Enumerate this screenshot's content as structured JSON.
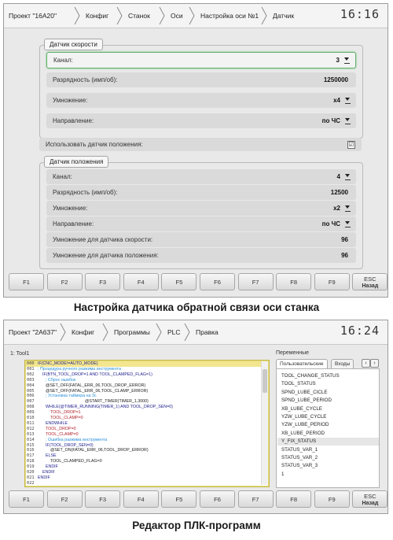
{
  "screen1": {
    "breadcrumb": [
      "Проект \"16А20\"",
      "Конфиг",
      "Станок",
      "Оси",
      "Настройка оси №1",
      "Датчик"
    ],
    "clock": "16:16",
    "speed_group": {
      "legend": "Датчик скорости",
      "rows": [
        {
          "label": "Канал:",
          "value": "3",
          "dropdown": true
        },
        {
          "label": "Разрядность (имп/об):",
          "value": "1250000",
          "dropdown": false
        },
        {
          "label": "Умножение:",
          "value": "x4",
          "dropdown": true
        },
        {
          "label": "Направление:",
          "value": "по ЧС",
          "dropdown": true
        }
      ]
    },
    "use_position_sensor": {
      "label": "Использовать датчик положения:",
      "checked": "☑"
    },
    "position_group": {
      "legend": "Датчик положения",
      "rows": [
        {
          "label": "Канал:",
          "value": "4",
          "dropdown": true
        },
        {
          "label": "Разрядность (имп/об):",
          "value": "12500",
          "dropdown": false
        },
        {
          "label": "Умножение:",
          "value": "x2",
          "dropdown": true
        },
        {
          "label": "Направление:",
          "value": "по ЧС",
          "dropdown": true
        },
        {
          "label": "Умножение для датчика скорости:",
          "value": "96",
          "dropdown": false
        },
        {
          "label": "Умножение для датчика положения:",
          "value": "96",
          "dropdown": false
        }
      ]
    },
    "fkeys": [
      "F1",
      "F2",
      "F3",
      "F4",
      "F5",
      "F6",
      "F7",
      "F8",
      "F9"
    ],
    "esc": {
      "top": "ESC",
      "bottom": "Назад"
    }
  },
  "caption1": "Настройка датчика обратной связи оси станка",
  "screen2": {
    "breadcrumb": [
      "Проект \"2А637\"",
      "Конфиг",
      "Программы",
      "PLC",
      "Правка"
    ],
    "clock": "16:24",
    "editor_title": "1: Tool1",
    "code_lines": [
      {
        "n": "000",
        "text": "IF(CNC_MODE!=AUTO_MODE)",
        "color": "#1d1d8c"
      },
      {
        "n": "001",
        "text": "; Процедура ручного разжима инструмента",
        "color": "#2a8fd8"
      },
      {
        "n": "002",
        "text": "IF(BTN_TOOL_DROP=1 AND TOOL_CLAMPED_FLAG=1)",
        "color": "#1d1d8c"
      },
      {
        "n": "003",
        "text": "; Сброс ошибок",
        "color": "#2a8fd8"
      },
      {
        "n": "004",
        "text": "@SET_OFF(FATAL_ERR_06,TOOL_DROP_ERROR)",
        "color": "#222"
      },
      {
        "n": "005",
        "text": "@SET_OFF(FATAL_ERR_06,TOOL_CLAMP_ERROR)",
        "color": "#222"
      },
      {
        "n": "006",
        "text": "; Установка таймера на 3с",
        "color": "#2a8fd8"
      },
      {
        "n": "007",
        "text": "@START_TIMER(TIMER_1,3000)",
        "color": "#222"
      },
      {
        "n": "008",
        "text": "WHILE(@TIMER_RUNNING(TIMER_1) AND TOOL_DROP_SEN=0)",
        "color": "#1d1d8c"
      },
      {
        "n": "009",
        "text": "TOOL_DROP=1",
        "color": "#b2222a"
      },
      {
        "n": "010",
        "text": "TOOL_CLAMP=0",
        "color": "#b2222a"
      },
      {
        "n": "011",
        "text": "ENDWHILE",
        "color": "#1d1d8c"
      },
      {
        "n": "012",
        "text": "TOOL_DROP=0",
        "color": "#b2222a"
      },
      {
        "n": "013",
        "text": "TOOL_CLAMP=0",
        "color": "#b2222a"
      },
      {
        "n": "014",
        "text": "; Ошибка разжима инструмента",
        "color": "#2a8fd8"
      },
      {
        "n": "015",
        "text": "IF(TOOL_DROP_SEN=0)",
        "color": "#1d1d8c"
      },
      {
        "n": "016",
        "text": "@SET_ON(FATAL_ERR_06,TOOL_DROP_ERROR)",
        "color": "#222"
      },
      {
        "n": "017",
        "text": "ELSE",
        "color": "#1d1d8c"
      },
      {
        "n": "018",
        "text": "TOOL_CLAMPED_FLAG=0",
        "color": "#222"
      },
      {
        "n": "019",
        "text": "ENDIF",
        "color": "#1d1d8c"
      },
      {
        "n": "020",
        "text": "ENDIF",
        "color": "#1d1d8c"
      },
      {
        "n": "021",
        "text": "ENDIF",
        "color": "#1d1d8c"
      },
      {
        "n": "022",
        "text": "",
        "color": "#222"
      }
    ],
    "vars_title": "Переменные",
    "vars_tabs": [
      "Пользовательские",
      "Входы"
    ],
    "vars_nav": [
      "‹",
      "›"
    ],
    "vars_list": [
      "TOOL_CHANGE_STATUS",
      "TOOL_STATUS",
      "SPND_LUBE_CICLE",
      "SPND_LUBE_PERIOD",
      "XB_LUBE_CYCLE",
      "YZW_LUBE_CYCLE",
      "YZW_LUBE_PERIOD",
      "XB_LUBE_PERIOD",
      "Y_FIX_STATUS",
      "STATUS_VAR_1",
      "STATUS_VAR_2",
      "STATUS_VAR_3",
      "1"
    ],
    "vars_selected": "Y_FIX_STATUS",
    "fkeys": [
      "F1",
      "F2",
      "F3",
      "F4",
      "F5",
      "F6",
      "F7",
      "F8",
      "F9"
    ],
    "esc": {
      "top": "ESC",
      "bottom": "Назад"
    }
  },
  "caption2": "Редактор ПЛК-программ"
}
